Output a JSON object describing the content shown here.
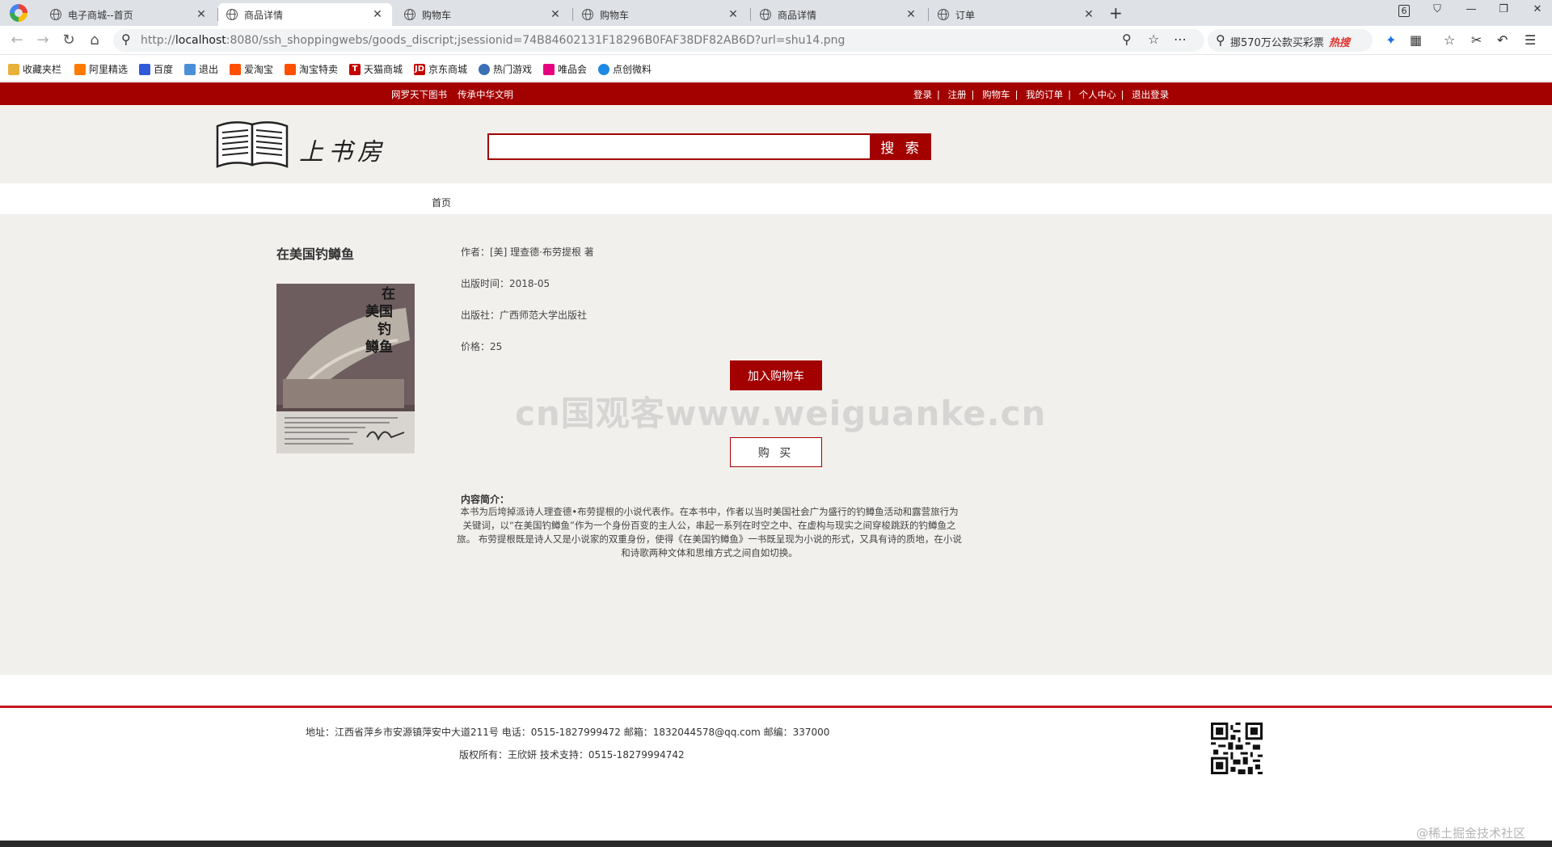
{
  "browser": {
    "tabs": [
      {
        "title": "电子商城--首页",
        "active": false
      },
      {
        "title": "商品详情",
        "active": true
      },
      {
        "title": "购物车",
        "active": false
      },
      {
        "title": "购物车",
        "active": false
      },
      {
        "title": "商品详情",
        "active": false
      },
      {
        "title": "订单",
        "active": false
      }
    ],
    "tab_count": "6",
    "url_prefix": "http://",
    "url_host": "localhost",
    "url_rest": ":8080/ssh_shoppingwebs/goods_discript;jsessionid=74B84602131F18296B0FAF38DF82AB6D?url=shu14.png",
    "hot_search_text": "挪570万公款买彩票",
    "hot_search_tag": "热搜",
    "bookmarks": [
      "收藏夹栏",
      "阿里精选",
      "百度",
      "退出",
      "爱淘宝",
      "淘宝特卖",
      "天猫商城",
      "京东商城",
      "热门游戏",
      "唯品会",
      "点创微料"
    ]
  },
  "site": {
    "slogan_1": "网罗天下图书",
    "slogan_2": "传承中华文明",
    "top_links": [
      "登录",
      "注册",
      "购物车",
      "我的订单",
      "个人中心",
      "退出登录"
    ],
    "logo_text": "上书房",
    "search_value": "",
    "search_button": "搜 索",
    "nav_home": "首页",
    "accent_color": "#a30000"
  },
  "product": {
    "title": "在美国钓鳟鱼",
    "author": "作者：[美] 理查德·布劳提根 著",
    "pub_date": "出版时间：2018-05",
    "publisher": "出版社：广西师范大学出版社",
    "price": "价格：25",
    "add_to_cart": "加入购物车",
    "buy": "购 买",
    "desc_label": "内容简介：",
    "desc_text": "本书为后垮掉派诗人理查德•布劳提根的小说代表作。在本书中，作者以当时美国社会广为盛行的钓鳟鱼活动和露营旅行为关键词，以“在美国钓鳟鱼”作为一个身份百变的主人公，串起一系列在时空之中、在虚构与现实之间穿梭跳跃的钓鳟鱼之旅。 布劳提根既是诗人又是小说家的双重身份，使得《在美国钓鳟鱼》一书既呈现为小说的形式，又具有诗的质地，在小说和诗歌两种文体和思维方式之间自如切换。"
  },
  "footer": {
    "address_line": "地址：江西省萍乡市安源镇萍安中大道211号   电话：0515-1827999472   邮箱：1832044578@qq.com   邮编：337000",
    "copyright_line": "版权所有：王欣妍   技术支持：0515-18279994742"
  },
  "overlay": {
    "watermark": "cn国观客www.weiguanke.cn",
    "corner_mark": "@稀土掘金技术社区"
  }
}
